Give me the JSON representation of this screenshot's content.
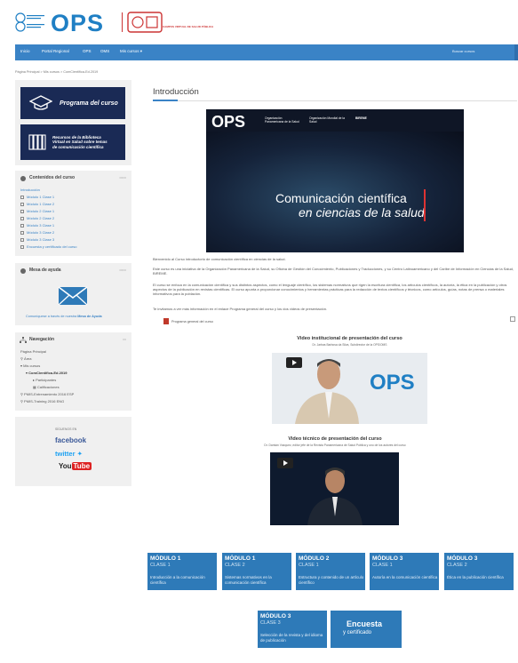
{
  "header": {
    "brand_text": "OPS",
    "cv_label": "CAMPUS VIRTUAL DE SALUD PÚBLICA"
  },
  "nav": {
    "items": [
      "Inicio",
      "Portal Regional",
      "OPS",
      "OMS",
      "Mis cursos ▾"
    ],
    "search_placeholder": "Buscar cursos"
  },
  "breadcrumb": "Página Principal  >  Mis cursos  >  ComCientifica-Ed.2019",
  "sidebar": {
    "program_btn": "Programa del curso",
    "library_btn": [
      "Recursos de la Biblioteca",
      "Virtual en Salud sobre temas",
      "de comunicación científica"
    ],
    "contents_header": "Contenidos del curso",
    "contents": [
      "Introducción",
      "Módulo 1 Clase 1",
      "Módulo 1 Clase 2",
      "Módulo 2 Clase 1",
      "Módulo 2 Clase 2",
      "Módulo 3 Clase 1",
      "Módulo 3 Clase 2",
      "Módulo 3 Clase 3",
      "Encuesta y certificado del curso"
    ],
    "help_header": "Mesa de ayuda",
    "help_text": "Comuníquese a través de nuestra",
    "help_link": "Mesa de Ayuda",
    "nav_header": "Navegación",
    "nav_tree": [
      "Página Principal",
      "Área",
      "Mis cursos",
      "ComCientifica-Ed.2019",
      "Participantes",
      "Calificaciones",
      "PMIS-Entrenamiento 2016 ESP",
      "PMIS-Training 2016 ENG"
    ],
    "social_label": "SÍGUENOS EN",
    "facebook": "facebook",
    "twitter": "twitter",
    "youtube_you": "You",
    "youtube_tube": "Tube"
  },
  "main": {
    "title": "Introducción",
    "hero": {
      "ops": "OPS",
      "badge1": "Organización Panamericana de la Salud",
      "badge2": "Organización Mundial de la Salud",
      "badge3": "BIREME",
      "title1": "Comunicación científica",
      "title2": "en ciencias de la salud"
    },
    "welcome": "Bienvenido al Curso introductorio de comunicación científica en ciencias de la salud.",
    "para1": "Este curso es una iniciativa de la Organización Panamericana de la Salud, su Oficina de Gestión del Conocimiento, Publicaciones y Traducciones, y su Centro Latinoamericano y del Caribe de Información en Ciencias de la Salud, BIREME.",
    "para2": "El curso se enfoca en la comunicación científica y sus distintos aspectos, como el lenguaje científico, los sistemas normativos que rigen la escritura científica, los artículos científicos, la autoría, la ética en la publicación y otros aspectos de la publicación en revistas científicas. El curso apunta a proporcionar conocimientos y herramientas prácticas para la redacción de textos científicos y técnicos, como artículos, guías, notas de prensa o materiales informativos para la población.",
    "para3": "Te invitamos a ver más información en el enlace Programa general del curso y los dos videos de presentación.",
    "pdf_link": "Programa general del curso",
    "video1_title": "Video institucional de presentación del curso",
    "video1_sub": "Dr. Jarbas Barbosa da Silva, Subdirector de la OPS/OMS",
    "video2_title": "Video técnico de presentación del curso",
    "video2_sub": "Dr. Damián Vázquez, editor jefe de la Revista Panamericana de Salud Pública y uno de los autores del curso",
    "modules": [
      {
        "m": "MÓDULO 1",
        "c": "CLASE 1",
        "t": "Introducción a la comunicación científica"
      },
      {
        "m": "MÓDULO 1",
        "c": "CLASE 2",
        "t": "Sistemas normativos en la comunicación científica"
      },
      {
        "m": "MÓDULO 2",
        "c": "CLASE 1",
        "t": "Estructura y contenido de un artículo científico"
      },
      {
        "m": "MÓDULO 3",
        "c": "CLASE 1",
        "t": "Autoría en la comunicación científica"
      },
      {
        "m": "MÓDULO 3",
        "c": "CLASE 2",
        "t": "Ética en la publicación científica"
      },
      {
        "m": "MÓDULO 3",
        "c": "CLASE 3",
        "t": "Selección de la revista y del idioma de publicación"
      }
    ],
    "survey": {
      "s1": "Encuesta",
      "s2": "y certificado"
    }
  },
  "colors": {
    "nav": "#3a83c6",
    "tile": "#2e7ab8",
    "banner": "#1a2a55"
  }
}
